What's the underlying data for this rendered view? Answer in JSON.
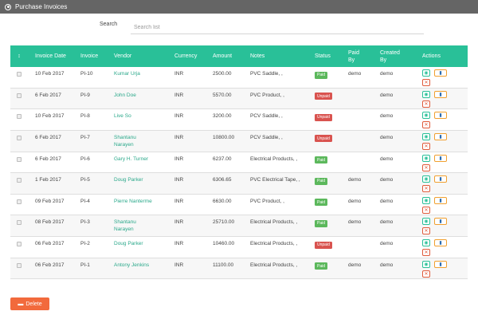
{
  "window": {
    "title": "Purchase Invoices"
  },
  "search": {
    "label": "Search",
    "placeholder": "Search list"
  },
  "columns": {
    "sort": "↕",
    "date": "Invoice Date",
    "invoice": "Invoice",
    "vendor": "Vendor",
    "currency": "Currency",
    "amount": "Amount",
    "notes": "Notes",
    "status": "Status",
    "paid_by": "Paid By",
    "created_by": "Created By",
    "actions": "Actions"
  },
  "rows": [
    {
      "date": "10 Feb 2017",
      "invoice": "PI-10",
      "vendor": [
        "Kumar Urja"
      ],
      "currency": "INR",
      "amount": "2500.00",
      "notes": "PVC Saddle, ,",
      "status": "Paid",
      "paid_by": "demo",
      "created_by": "demo"
    },
    {
      "date": "6 Feb 2017",
      "invoice": "PI-9",
      "vendor": [
        "John Doe"
      ],
      "currency": "INR",
      "amount": "5570.00",
      "notes": "PVC Product, ,",
      "status": "Unpaid",
      "paid_by": "",
      "created_by": "demo"
    },
    {
      "date": "10 Feb 2017",
      "invoice": "PI-8",
      "vendor": [
        "Live So"
      ],
      "currency": "INR",
      "amount": "3200.00",
      "notes": "PCV Saddle, ,",
      "status": "Unpaid",
      "paid_by": "",
      "created_by": "demo"
    },
    {
      "date": "6 Feb 2017",
      "invoice": "PI-7",
      "vendor": [
        "Shantanu",
        "Narayen"
      ],
      "currency": "INR",
      "amount": "10800.00",
      "notes": "PCV Saddle, ,",
      "status": "Unpaid",
      "paid_by": "",
      "created_by": "demo"
    },
    {
      "date": "6 Feb 2017",
      "invoice": "PI-6",
      "vendor": [
        "Gary H. Turner"
      ],
      "currency": "INR",
      "amount": "6237.00",
      "notes": "Electrical Products, ,",
      "status": "Paid",
      "paid_by": "",
      "created_by": "demo"
    },
    {
      "date": "1 Feb 2017",
      "invoice": "PI-5",
      "vendor": [
        "Doug Parker"
      ],
      "currency": "INR",
      "amount": "6306.65",
      "notes": "PVC Electrical Tape, ,",
      "status": "Paid",
      "paid_by": "demo",
      "created_by": "demo"
    },
    {
      "date": "09 Feb 2017",
      "invoice": "PI-4",
      "vendor": [
        "Pierre Nanterme"
      ],
      "currency": "INR",
      "amount": "6630.00",
      "notes": "PVC Product, ,",
      "status": "Paid",
      "paid_by": "demo",
      "created_by": "demo"
    },
    {
      "date": "08 Feb 2017",
      "invoice": "PI-3",
      "vendor": [
        "Shantanu",
        "Narayen"
      ],
      "currency": "INR",
      "amount": "25710.00",
      "notes": "Electrical Products, ,",
      "status": "Paid",
      "paid_by": "demo",
      "created_by": "demo"
    },
    {
      "date": "06 Feb 2017",
      "invoice": "PI-2",
      "vendor": [
        "Doug Parker"
      ],
      "currency": "INR",
      "amount": "10460.00",
      "notes": "Electrical Products, ,",
      "status": "Unpaid",
      "paid_by": "",
      "created_by": "demo"
    },
    {
      "date": "06 Feb 2017",
      "invoice": "PI-1",
      "vendor": [
        "Antony Jenkins"
      ],
      "currency": "INR",
      "amount": "11100.00",
      "notes": "Electrical Products, ,",
      "status": "Paid",
      "paid_by": "demo",
      "created_by": "demo"
    }
  ],
  "footer": {
    "delete_label": "Delete"
  },
  "icons": {
    "view": "eye-icon",
    "print": "print-icon",
    "delete": "close-icon",
    "trash": "trash-icon",
    "title": "circle-icon"
  },
  "colors": {
    "header_bar": "#656565",
    "table_header": "#29c098",
    "paid": "#5cb85c",
    "unpaid": "#d9534f",
    "delete_button": "#f26a3c",
    "vendor_link": "#2aa88a"
  }
}
